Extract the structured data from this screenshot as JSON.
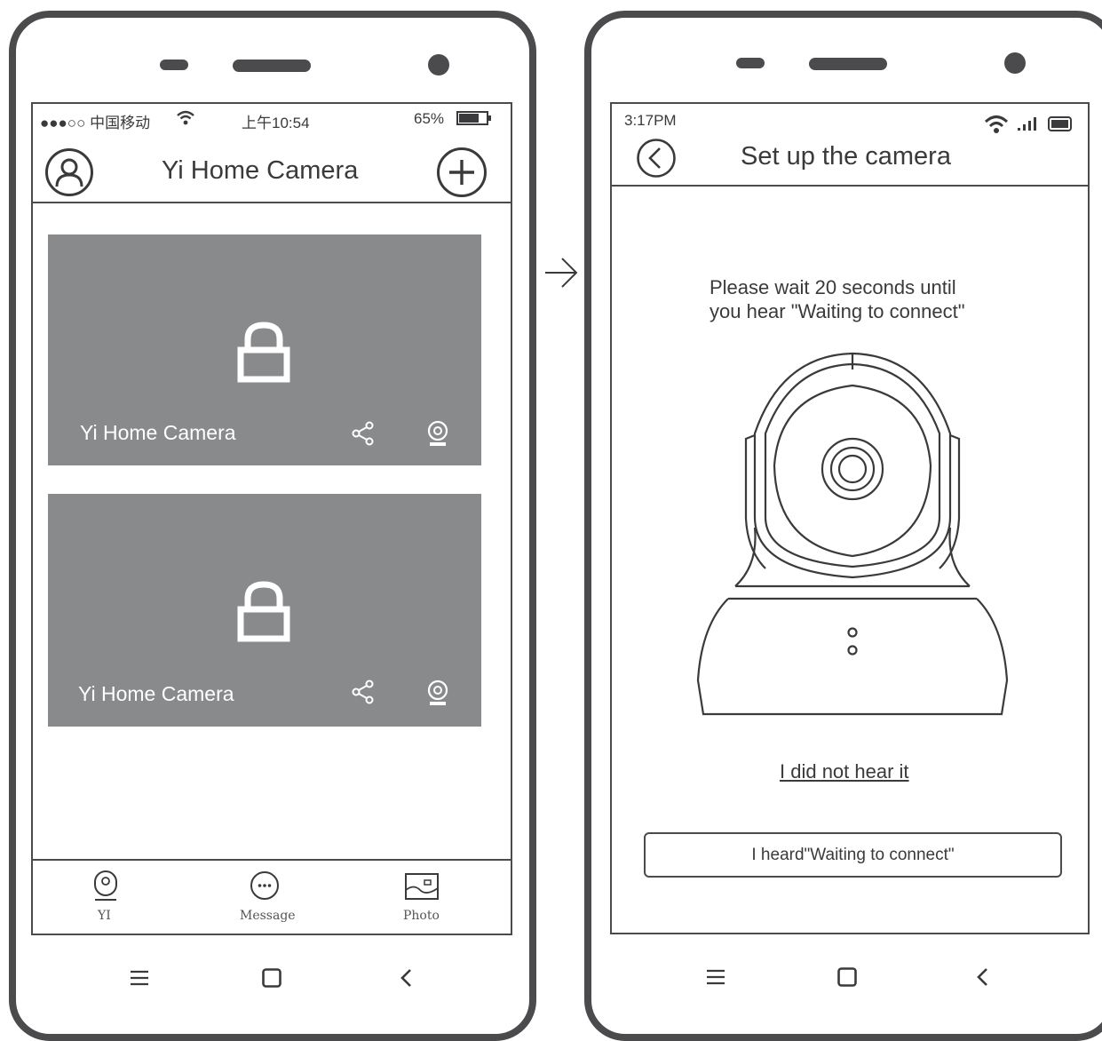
{
  "arrow_icon": "arrow-right-icon",
  "left_phone": {
    "status_bar": {
      "carrier": "●●●○○ 中国移动",
      "time": "上午10:54",
      "battery": "65%"
    },
    "header": {
      "title": "Yi Home Camera",
      "profile_icon": "user-icon",
      "add_icon": "plus-circle-icon"
    },
    "cameras": [
      {
        "name": "Yi Home Camera",
        "status_icon": "lock-icon",
        "actions": [
          "share-icon",
          "camera-icon"
        ]
      },
      {
        "name": "Yi Home Camera",
        "status_icon": "lock-icon",
        "actions": [
          "share-icon",
          "camera-icon"
        ]
      }
    ],
    "bottom_nav": [
      {
        "label": "YI",
        "icon": "camera-icon"
      },
      {
        "label": "Message",
        "icon": "message-icon"
      },
      {
        "label": "Photo",
        "icon": "photo-icon"
      }
    ],
    "system_nav": [
      "menu-icon",
      "home-icon",
      "back-icon"
    ]
  },
  "right_phone": {
    "status_bar": {
      "time": "3:17PM"
    },
    "header": {
      "title": "Set up the camera",
      "back_icon": "chevron-left-circle-icon"
    },
    "instruction_line1": "Please wait 20 seconds until",
    "instruction_line2": "you hear \"Waiting to connect\"",
    "illustration": "yi-home-camera-illustration",
    "link": "I did not hear it",
    "button": "I heard\"Waiting to connect\"",
    "system_nav": [
      "menu-icon",
      "home-icon",
      "back-icon"
    ]
  }
}
